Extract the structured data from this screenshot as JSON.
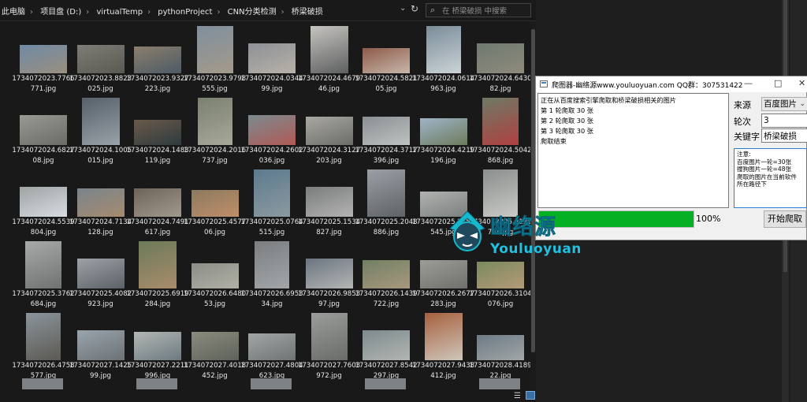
{
  "explorer": {
    "breadcrumbs": [
      "此电脑",
      "项目盘 (D:)",
      "virtualTemp",
      "pythonProject",
      "CNN分类检测",
      "桥梁破损"
    ],
    "search_placeholder": "在 桥梁破损 中搜索",
    "files": [
      "1734072023.7766771.jpg",
      "1734072023.8823025.jpg",
      "1734072023.9327223.jpg",
      "1734072023.9798555.jpg",
      "1734072024.034499.jpg",
      "1734072024.467946.jpg",
      "1734072024.582105.jpg",
      "1734072024.0614963.jpg",
      "1734072024.643082.jpg",
      "1734072024.682708.jpg",
      "1734072024.1005015.jpg",
      "1734072024.1483119.jpg",
      "1734072024.2016737.jpg",
      "1734072024.2602036.jpg",
      "1734072024.3127203.jpg",
      "1734072024.3717396.jpg",
      "1734072024.4219196.jpg",
      "1734072024.5042868.jpg",
      "1734072024.5539804.jpg",
      "1734072024.7134128.jpg",
      "1734072024.7491617.jpg",
      "1734072025.457706.jpg",
      "1734072025.0764515.jpg",
      "1734072025.1534827.jpg",
      "1734072025.2048886.jpg",
      "1734072025.2350545.jpg",
      "1734072025.3139758.jpg",
      "1734072025.3762684.jpg",
      "1734072025.4082923.jpg",
      "1734072025.6919284.jpg",
      "1734072026.648053.jpg",
      "1734072026.695334.jpg",
      "1734072026.985397.jpg",
      "1734072026.1439722.jpg",
      "1734072026.2677283.jpg",
      "1734072026.3104076.jpg",
      "1734072026.4758577.jpg",
      "1734072027.142599.jpg",
      "1734072027.2211996.jpg",
      "1734072027.4018452.jpg",
      "1734072027.4804623.jpg",
      "1734072027.7603972.jpg",
      "1734072027.8542297.jpg",
      "1734072027.9438412.jpg",
      "1734072028.418922.jpg"
    ],
    "thumb_colors": [
      [
        "#6f8aa6",
        "#9a8f7e"
      ],
      [
        "#7d7d75",
        "#5a5a52"
      ],
      [
        "#8a7f6c",
        "#4d5a66"
      ],
      [
        "#7f8f9e",
        "#a49a8a"
      ],
      [
        "#8d9096",
        "#b8b2a8"
      ],
      [
        "#c6c4c0",
        "#5d6060"
      ],
      [
        "#8e5a4a",
        "#c7b8aa"
      ],
      [
        "#7a8c99",
        "#cbd3d6"
      ],
      [
        "#6e7a70",
        "#8f8a7c"
      ],
      [
        "#9a9a94",
        "#6b6b66"
      ],
      [
        "#55606a",
        "#9aa2a8"
      ],
      [
        "#6a5a4a",
        "#2f3a3f"
      ],
      [
        "#7a8070",
        "#a8a89a"
      ],
      [
        "#7c8a90",
        "#b05a55"
      ],
      [
        "#a9a8a3",
        "#6c6c68"
      ],
      [
        "#8a8f92",
        "#bfc2c2"
      ],
      [
        "#9fb4c7",
        "#6c7b5c"
      ],
      [
        "#6d7a66",
        "#b04040"
      ],
      [
        "#9ea3a3",
        "#d6dce2"
      ],
      [
        "#7a838c",
        "#a58c6e"
      ],
      [
        "#6d6458",
        "#a09a8c"
      ],
      [
        "#8b7a5e",
        "#c08e6a"
      ],
      [
        "#5c7a8e",
        "#8b9aa0"
      ],
      [
        "#7a7c7d",
        "#b3b4b2"
      ],
      [
        "#9aa0a6",
        "#5f6266"
      ],
      [
        "#b0b3b0",
        "#7b7f7d"
      ],
      [
        "#8a8e8c",
        "#c9cac6"
      ],
      [
        "#a7aaa9",
        "#6e7270"
      ],
      [
        "#9ca2a6",
        "#5b6166"
      ],
      [
        "#6c7a5a",
        "#a88c6a"
      ],
      [
        "#8b8e87",
        "#b1b0a6"
      ],
      [
        "#7b7e80",
        "#a3a6a8"
      ],
      [
        "#6a7480",
        "#b4b6b4"
      ],
      [
        "#718063",
        "#a89880"
      ],
      [
        "#9c9d99",
        "#6f6f6b"
      ],
      [
        "#7a8a5e",
        "#b49a78"
      ],
      [
        "#8a949c",
        "#5c5a52"
      ],
      [
        "#9aa4ac",
        "#6c7276"
      ],
      [
        "#b3b6b4",
        "#6c7a80"
      ],
      [
        "#8a8c7e",
        "#5f625a"
      ],
      [
        "#a2a6a6",
        "#6e7374"
      ],
      [
        "#9b9d9a",
        "#6a6c69"
      ],
      [
        "#7e8a8e",
        "#b2b6b2"
      ],
      [
        "#a6603e",
        "#cfc6ba"
      ],
      [
        "#6c7a86",
        "#a2a6a6"
      ]
    ]
  },
  "dialog": {
    "title": "爬图器-幽络源www.youluoyuan.com QQ群：307531422",
    "minimize": "—",
    "maximize": "□",
    "close": "✕",
    "log": [
      "正在从百度搜索引擎爬取和桥梁破损相关的图片",
      "第 1 轮爬取 30 张",
      "第 2 轮爬取 30 张",
      "第 3 轮爬取 30 张",
      "爬取结束"
    ],
    "source_label": "来源",
    "source_value": "百度图片",
    "rounds_label": "轮次",
    "rounds_value": "3",
    "keyword_label": "关键字",
    "keyword_value": "桥梁破损",
    "notes": [
      "注意:",
      "百度图片一轮=30张",
      "搜狗图片一轮=48张",
      "爬取的图片在当前软件",
      "所在路径下"
    ],
    "progress": 1.0,
    "progress_text": "100%",
    "start_button": "开始爬取"
  },
  "watermark": {
    "name": "幽络源",
    "latin": "Youluoyuan"
  },
  "colors": {
    "explorer_bg": "#191919",
    "progress_fill": "#06b025",
    "watermark": "#16b9cc"
  }
}
